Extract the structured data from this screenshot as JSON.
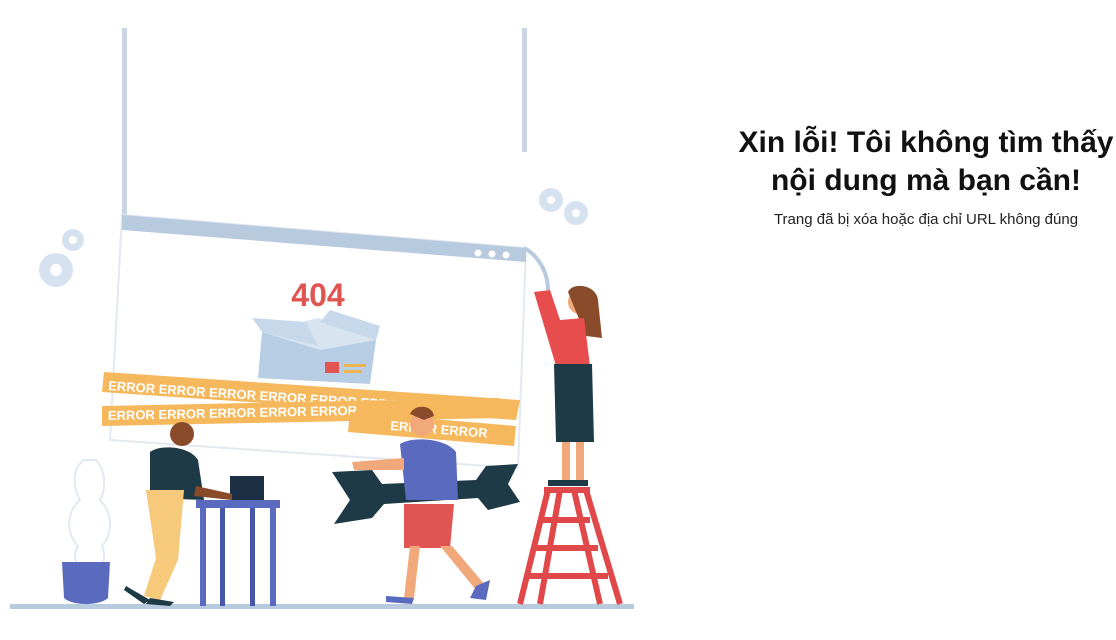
{
  "illustration": {
    "error_code": "404",
    "tape_word": "ERROR"
  },
  "message": {
    "title_line1": "Xin lỗi! Tôi không tìm thấy",
    "title_line2": "nội dung mà bạn cần!",
    "subtitle": "Trang đã bị xóa hoặc địa chỉ URL không đúng"
  }
}
